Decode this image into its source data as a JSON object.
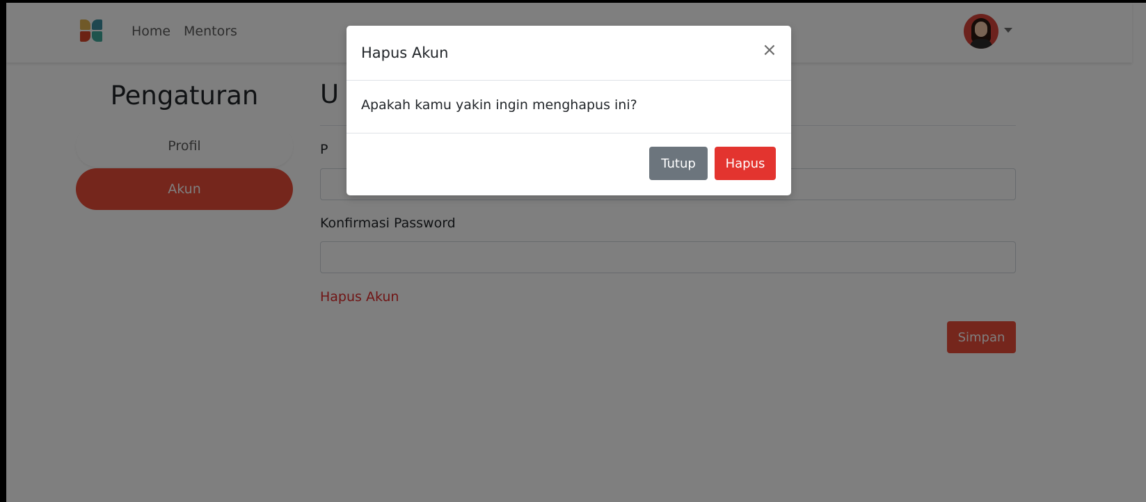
{
  "navbar": {
    "logo_icon": "app-logo-icon",
    "links": [
      "Home",
      "Mentors"
    ],
    "avatar_icon": "user-avatar",
    "dropdown_icon": "caret-down-icon"
  },
  "sidebar": {
    "title": "Pengaturan",
    "items": [
      {
        "label": "Profil",
        "active": false
      },
      {
        "label": "Akun",
        "active": true
      }
    ]
  },
  "content": {
    "title": "U",
    "password_label": "P",
    "password_value": "",
    "confirm_label": "Konfirmasi Password",
    "confirm_value": "",
    "delete_link": "Hapus Akun",
    "save_label": "Simpan"
  },
  "modal": {
    "title": "Hapus Akun",
    "close_symbol": "×",
    "message": "Apakah kamu yakin ingin menghapus ini?",
    "cancel_label": "Tutup",
    "confirm_label": "Hapus"
  },
  "colors": {
    "accent": "#ea4c39",
    "danger": "#e3342f",
    "secondary": "#6c757d",
    "backdrop": "rgba(0,0,0,0.5)"
  }
}
